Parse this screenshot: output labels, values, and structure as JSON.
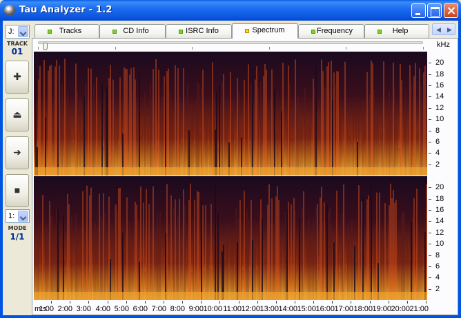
{
  "window": {
    "title": "Tau Analyzer - 1.2"
  },
  "icons": {
    "app": "cd-disc-icon",
    "minimize": "minimize-icon",
    "maximize": "maximize-icon",
    "close": "close-icon"
  },
  "sidebar": {
    "drive_value": "J:",
    "track_label": "TRACK",
    "track_value": "01",
    "buttons": [
      {
        "name": "add",
        "glyph": "✚"
      },
      {
        "name": "eject",
        "glyph": "⏏"
      },
      {
        "name": "play",
        "glyph": "➜"
      },
      {
        "name": "stop",
        "glyph": "■"
      }
    ],
    "mode_combo_value": "1:",
    "mode_label": "MODE",
    "mode_value": "1/1"
  },
  "tabs": [
    {
      "label": "Tracks",
      "active": false
    },
    {
      "label": "CD Info",
      "active": false
    },
    {
      "label": "ISRC Info",
      "active": false
    },
    {
      "label": "Spectrum",
      "active": true
    },
    {
      "label": "Frequency",
      "active": false
    },
    {
      "label": "Help",
      "active": false
    }
  ],
  "spectrum": {
    "unit_label": "kHz",
    "freq_labels": [
      "20",
      "18",
      "16",
      "14",
      "12",
      "10",
      "8",
      "6",
      "4",
      "2"
    ],
    "time_axis_prefix": "m:s",
    "time_labels": [
      "1:00",
      "2:00",
      "3:00",
      "4:00",
      "5:00",
      "6:00",
      "7:00",
      "8:00",
      "9:00",
      "10:00",
      "11:00",
      "12:00",
      "13:00",
      "14:00",
      "15:00",
      "16:00",
      "17:00",
      "18:00",
      "19:00",
      "20:00",
      "21:00"
    ],
    "colors": {
      "low": "#1a0a1e",
      "mid": "#8a2a10",
      "high": "#f4a020",
      "peak": "#fff0a8"
    }
  }
}
